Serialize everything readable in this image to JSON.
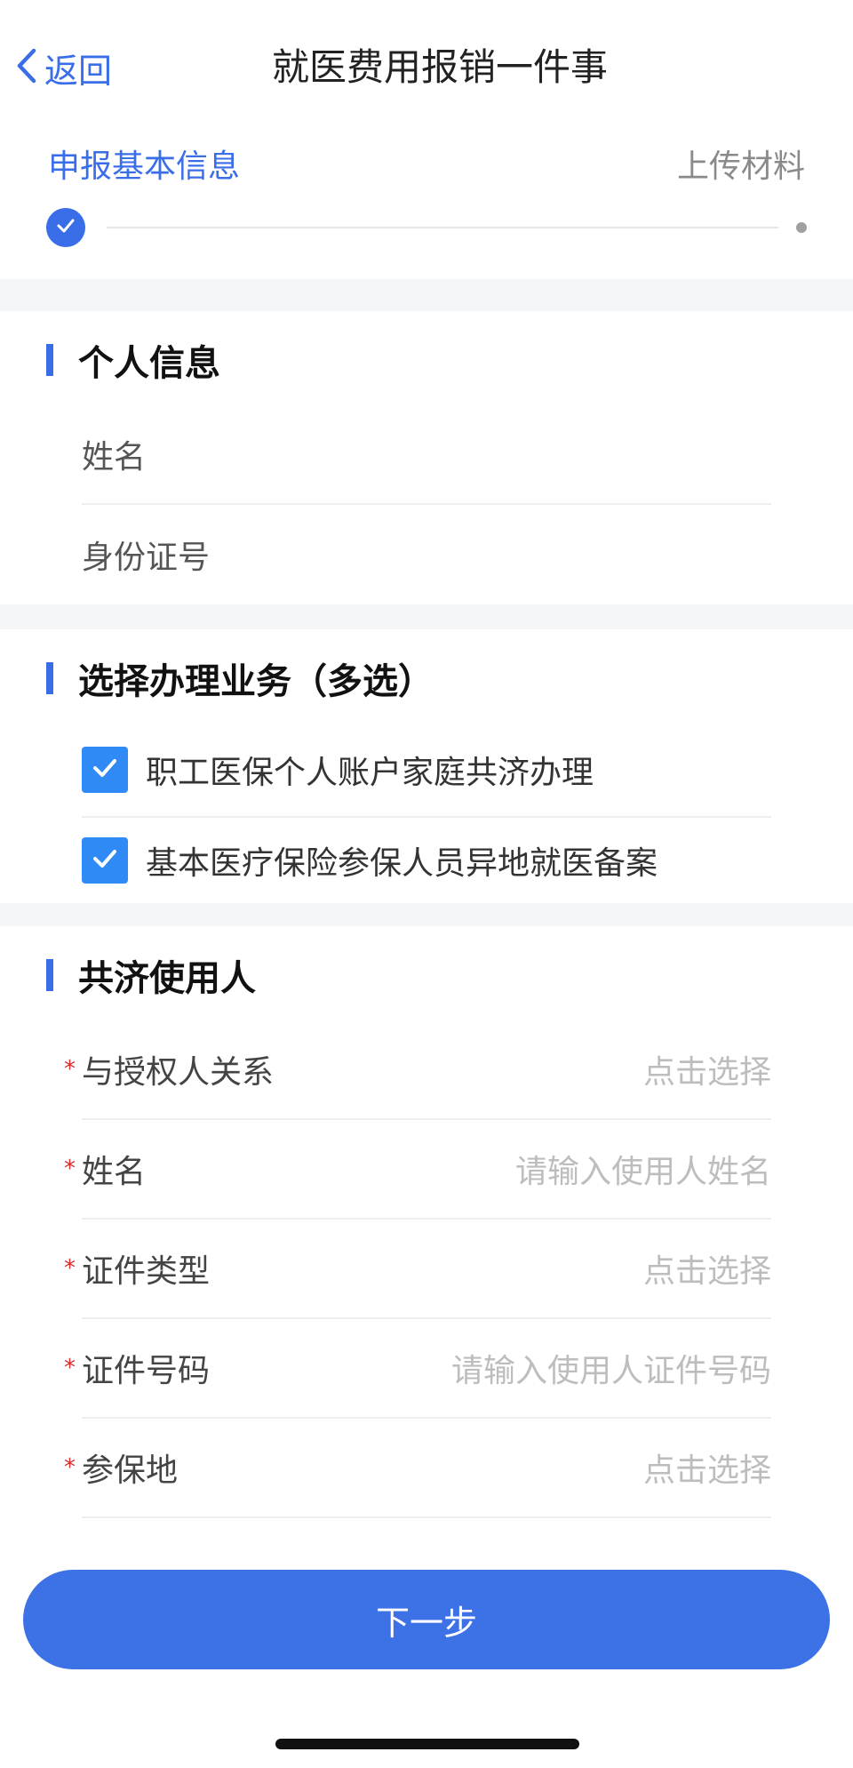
{
  "navbar": {
    "back_label": "返回",
    "title": "就医费用报销一件事"
  },
  "steps": {
    "items": [
      {
        "label": "申报基本信息",
        "state": "done"
      },
      {
        "label": "上传材料",
        "state": "pending"
      }
    ]
  },
  "personal_info": {
    "title": "个人信息",
    "name_label": "姓名",
    "id_label": "身份证号"
  },
  "business": {
    "title": "选择办理业务（多选）",
    "options": [
      {
        "label": "职工医保个人账户家庭共济办理",
        "checked": true
      },
      {
        "label": "基本医疗保险参保人员异地就医备案",
        "checked": true
      }
    ]
  },
  "co_user": {
    "title": "共济使用人",
    "fields": [
      {
        "label": "与授权人关系",
        "placeholder": "点击选择",
        "required_mark": "*"
      },
      {
        "label": "姓名",
        "placeholder": "请输入使用人姓名",
        "required_mark": "*"
      },
      {
        "label": "证件类型",
        "placeholder": "点击选择",
        "required_mark": "*"
      },
      {
        "label": "证件号码",
        "placeholder": "请输入使用人证件号码",
        "required_mark": "*"
      },
      {
        "label": "参保地",
        "placeholder": "点击选择",
        "required_mark": "*"
      }
    ]
  },
  "footer": {
    "next_label": "下一步"
  },
  "colors": {
    "accent": "#3a6ee8",
    "checkbox": "#2f8af5",
    "required": "#e02b2b",
    "placeholder": "#bdbdbd"
  }
}
